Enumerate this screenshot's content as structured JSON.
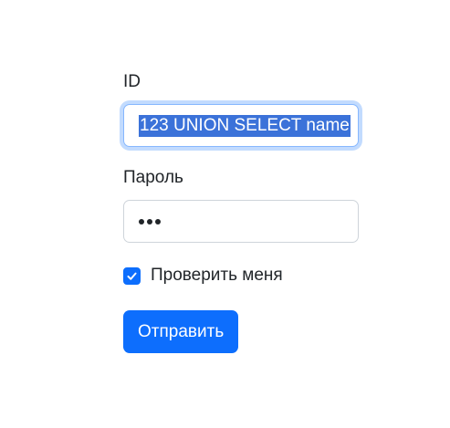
{
  "form": {
    "id_field": {
      "label": "ID",
      "value": "123 UNION SELECT name"
    },
    "password_field": {
      "label": "Пароль",
      "masked_length": 3
    },
    "remember_checkbox": {
      "label": "Проверить меня",
      "checked": true
    },
    "submit_label": "Отправить"
  },
  "colors": {
    "accent": "#0d6efd",
    "focus_ring": "#86b7fe",
    "selection": "#3b72d9",
    "text": "#212529",
    "border": "#ced4da"
  },
  "icons": {
    "checkbox_mark": "checkmark-icon"
  }
}
